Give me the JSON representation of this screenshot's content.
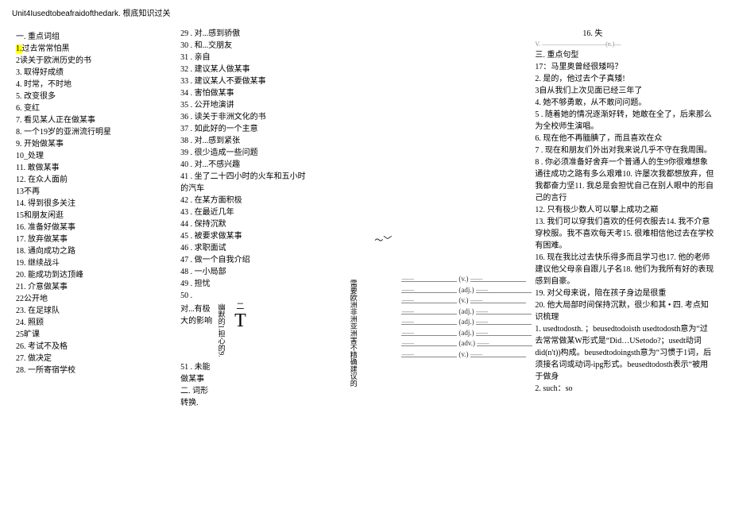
{
  "header": "Unit4Iusedtobeafraidofthedark. 根底知识过关",
  "col1": {
    "title": "一. 重点词组",
    "items": [
      {
        "n": "1.",
        "t": "过去常常怕黑",
        "hl": true
      },
      {
        "n": "2",
        "t": "读关于欧洲历史的书"
      },
      {
        "n": "3",
        "t": ". 取得好成绩"
      },
      {
        "n": "4",
        "t": ". 时常，不时地"
      },
      {
        "n": "5",
        "t": ". 改变很多"
      },
      {
        "n": "6",
        "t": ". 变红"
      },
      {
        "n": "7",
        "t": ". 看见某人正在做某事"
      },
      {
        "n": "8",
        "t": ". 一个19岁的亚洲流行明星"
      },
      {
        "n": "9",
        "t": ". 开始做某事"
      },
      {
        "n": "10_",
        "t": "处理"
      },
      {
        "n": "11",
        "t": ". 敢做某事"
      },
      {
        "n": "12",
        "t": ". 在众人面前"
      },
      {
        "n": "13",
        "t": "不再"
      },
      {
        "n": "14",
        "t": ". 得到很多关注"
      },
      {
        "n": "15",
        "t": "和朋友闲逛"
      },
      {
        "n": "16",
        "t": ". 准备好做某事"
      },
      {
        "n": "17",
        "t": ". 放弃做某事"
      },
      {
        "n": "18",
        "t": ". 通向成功之路"
      },
      {
        "n": "19",
        "t": ". 继续战斗"
      },
      {
        "n": "20",
        "t": ". 能成功到达顶峰"
      },
      {
        "n": "21",
        "t": ". 介意做某事"
      },
      {
        "n": "22",
        "t": "公开地"
      },
      {
        "n": "23",
        "t": ". 在足球队"
      },
      {
        "n": "24",
        "t": ". 照顾"
      },
      {
        "n": "25",
        "t": "旷课"
      },
      {
        "n": "26",
        "t": ". 考试不及格"
      },
      {
        "n": "27",
        "t": ". 做决定"
      },
      {
        "n": "28",
        "t": ". 一所寄宿学校"
      }
    ]
  },
  "col2": {
    "items": [
      {
        "n": "29",
        "t": ". 对...感到骄傲"
      },
      {
        "n": "30",
        "t": ". 和...交朋友"
      },
      {
        "n": "31",
        "t": ". 亲自"
      },
      {
        "n": "32",
        "t": ". 建议某人做某事"
      },
      {
        "n": "33",
        "t": ". 建议某人不要做某事"
      },
      {
        "n": "34",
        "t": ". 害怕做某事"
      },
      {
        "n": "35",
        "t": ". 公开地演讲"
      },
      {
        "n": "36",
        "t": ". 读关于非洲文化的书"
      },
      {
        "n": "37",
        "t": ". 如此好的一个主意"
      },
      {
        "n": "38",
        "t": ". 对...感到紧张"
      },
      {
        "n": "39",
        "t": ". 很少造成一些问题"
      },
      {
        "n": "40",
        "t": ". 对...不感兴趣"
      },
      {
        "n": "41",
        "t": ". 坐了二十四小时的火车和五小时的汽车"
      },
      {
        "n": "42",
        "t": ". 在某方面积极"
      },
      {
        "n": "43",
        "t": ". 在最近几年"
      },
      {
        "n": "44",
        "t": ". 保持沉默"
      },
      {
        "n": "45",
        "t": ". 被要求做某事"
      },
      {
        "n": "46",
        "t": ". 求职面试"
      },
      {
        "n": "47",
        "t": ". 做一个自我介绍"
      },
      {
        "n": "48",
        "t": ". 一小局部"
      },
      {
        "n": "49",
        "t": ". 担忧"
      },
      {
        "n": "50",
        "t": "."
      }
    ],
    "tail": {
      "a": "对...有极大的影响",
      "b": "51 . 未能做某事",
      "c": "二. 词形转换."
    }
  },
  "col3": {
    "vert1": "需要欧洲非洲亚洲害不精确建议的",
    "vert2": "幽默的1.担心的9.",
    "big": "T",
    "two": "二",
    "mark": "〜﹀"
  },
  "col4": {
    "rows": [
      "(v.)",
      "(adj.)",
      "(v.)",
      "(adj.)",
      "(adj.)",
      "(adj.)",
      "(adv.)",
      "(v.)"
    ]
  },
  "col5": {
    "top": "16. 失",
    "vline": "V. ——————————(n.)—",
    "title": "三. 重点句型",
    "items": [
      "17：马里奥曾经很矮吗？",
      "2. 是的，他过去个子真矮!",
      "3自从我们上次见面已经三年了",
      "4. 她不够勇敢，从不敢问问题。",
      "5 . 随着她的情况逐渐好转，她敢在全了，后来那么为全校师生演唱。",
      "6. 现在他不再腼腆了，而且喜欢在众",
      "7 . 现在和朋友们外出对我来说几乎不守在我周围。",
      "8 . 你必须准备好舍弃一个普通人的生9你很难想象通往成功之路有多么艰难10. 许屡次我都想放弃，但我都奋力坚11. 我总是会担忧自己在别人眼中的形自己的言行",
      "12. 只有极少数人可以攀上成功之巅",
      "13. 我们可以穿我们喜欢的任何衣服去14. 我不介意穿校服。我不喜欢每天考15. 很难相信他过去在学校有困难。",
      "16. 现在我比过去快乐得多而且学习也17. 他的老师建议他父母亲自跟儿子名18. 他们为我所有好的表现感到自豪。",
      "19. 对父母来说，陪在孩子身边是很重",
      "20. 他大局部时间保持沉默，很少和其 • 四. 考点知识梳理",
      "1. usedtodosth. ；beusedtodoisth usedtodosth意为“过去常常做某W形式是“Did…USetodo?；usedt动词did(n't))构成。beusedtodoingsth意为“习惯于1词，后须接名词或动词-ipg形式。beusedtodosth表示“被用于做身",
      "2. such：so"
    ]
  }
}
